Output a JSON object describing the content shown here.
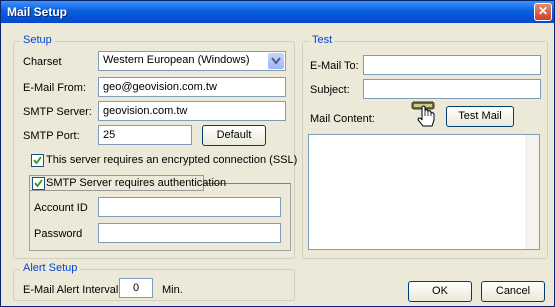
{
  "window": {
    "title": "Mail Setup",
    "close_label": "✕"
  },
  "setup": {
    "group_label": "Setup",
    "charset_label": "Charset",
    "charset_value": "Western European (Windows)",
    "email_from_label": "E-Mail From:",
    "email_from_value": "geo@geovision.com.tw",
    "smtp_server_label": "SMTP Server:",
    "smtp_server_value": "geovision.com.tw",
    "smtp_port_label": "SMTP Port:",
    "smtp_port_value": "25",
    "default_button": "Default",
    "ssl_label": "This server requires an encrypted connection (SSL)",
    "ssl_checked": true,
    "auth_label": "SMTP Server requires authentication",
    "auth_checked": true,
    "account_id_label": "Account ID",
    "account_id_value": "",
    "password_label": "Password",
    "password_value": ""
  },
  "test": {
    "group_label": "Test",
    "email_to_label": "E-Mail To:",
    "email_to_value": "",
    "subject_label": "Subject:",
    "subject_value": "",
    "mail_content_label": "Mail Content:",
    "test_mail_button": "Test Mail",
    "mail_content_value": ""
  },
  "alert": {
    "group_label": "Alert Setup",
    "interval_label": "E-Mail Alert Interval:",
    "interval_value": "0",
    "interval_unit": "Min."
  },
  "footer": {
    "ok_button": "OK",
    "cancel_button": "Cancel"
  },
  "colors": {
    "title_bar": "#0a5fe0",
    "group_label": "#0046d5",
    "dialog_bg": "#ece9d8"
  },
  "icons": [
    "close-icon",
    "dropdown-arrow-icon",
    "checkmark-icon",
    "hand-pointer-icon"
  ]
}
